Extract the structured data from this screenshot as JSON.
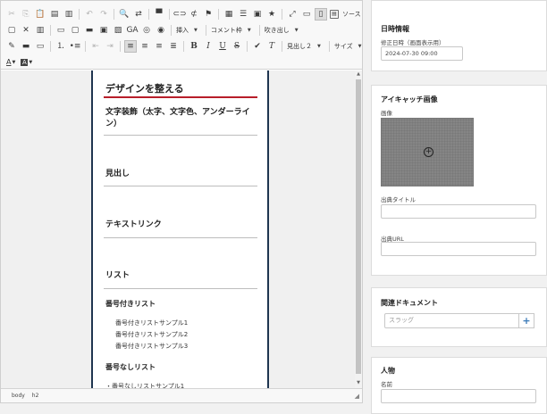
{
  "editor": {
    "toolbar": {
      "source_label": "ソース",
      "insert_label": "挿入",
      "comment_label": "コメント枠",
      "balloon_label": "吹き出し",
      "heading_label": "見出し２",
      "size_label": "サイズ",
      "ga_label": "GA"
    },
    "content": {
      "title": "デザインを整える",
      "section_text_decoration": "文字装飾（太字、文字色、アンダーライン）",
      "section_heading": "見出し",
      "section_text_link": "テキストリンク",
      "section_list": "リスト",
      "ordered_list_title": "番号付きリスト",
      "ordered_items": [
        "番号付きリストサンプル1",
        "番号付きリストサンプル2",
        "番号付きリストサンプル3"
      ],
      "unordered_list_title": "番号なしリスト",
      "unordered_items": [
        "・番号なしリストサンプル1"
      ]
    },
    "statusbar": {
      "path": [
        "body",
        "h2"
      ]
    }
  },
  "sidebar": {
    "datetime": {
      "title": "日時情報",
      "modified_label": "修正日時（画面表示用）",
      "modified_value": "2024-07-30 09:00"
    },
    "eyecatch": {
      "title": "アイキャッチ画像",
      "image_label": "画像",
      "source_title_label": "出典タイトル",
      "source_url_label": "出典URL"
    },
    "related": {
      "title": "関連ドキュメント",
      "slug_placeholder": "スラッグ",
      "add_label": "+"
    },
    "person": {
      "title": "人物",
      "name_label": "名前"
    }
  }
}
